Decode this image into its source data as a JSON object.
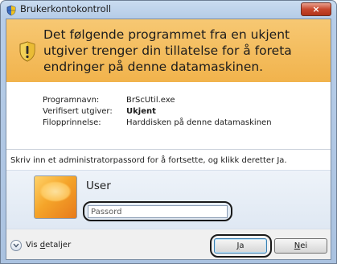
{
  "window": {
    "title": "Brukerkontokontroll",
    "close_label": "×"
  },
  "banner": {
    "message": "Det følgende programmet fra en ukjent utgiver trenger din tillatelse for å foreta endringer på denne datamaskinen."
  },
  "details": [
    {
      "key": "Programnavn:",
      "value": "BrScUtil.exe"
    },
    {
      "key": "Verifisert utgiver:",
      "value": "Ukjent"
    },
    {
      "key": "Filopprinnelse:",
      "value": "Harddisken på denne datamaskinen"
    }
  ],
  "prompt": "Skriv inn et administratorpassord for å fortsette, og klikk deretter Ja.",
  "credential": {
    "user_name": "User",
    "password_placeholder": "Passord",
    "password_value": ""
  },
  "footer": {
    "details_prefix": "Vis ",
    "details_underlined": "d",
    "details_rest": "etaljer",
    "yes_underlined": "J",
    "yes_rest": "a",
    "no_underlined": "N",
    "no_rest": "ei"
  },
  "colors": {
    "banner": "#f1b34c",
    "titlebar": "#b7cde8",
    "close": "#c8472d"
  },
  "icons": {
    "title": "uac-shield-icon",
    "banner": "warning-shield-icon",
    "expand": "chevron-down-icon"
  }
}
